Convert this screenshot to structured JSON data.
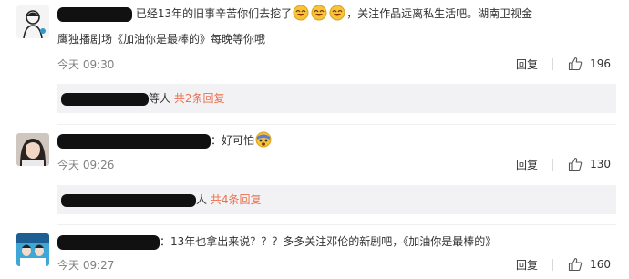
{
  "comments": [
    {
      "text_line1": "已经13年的旧事辛苦你们去挖了",
      "text_line1_after": "，关注作品远离私生活吧。湖南卫视金",
      "text_line2": "鹰独播剧场《加油你是最棒的》每晚等你哦",
      "time": "今天 09:30",
      "reply_label": "回复",
      "likes": "196",
      "thread": {
        "suffix": "等人",
        "more": "共2条回复"
      }
    },
    {
      "text": "：好可怕",
      "time": "今天 09:26",
      "reply_label": "回复",
      "likes": "130",
      "thread": {
        "suffix": "人",
        "more": "共4条回复"
      }
    },
    {
      "text": "：13年也拿出来说？？？多多关注邓伦的新剧吧，《加油你是最棒的》",
      "time": "今天 09:27",
      "reply_label": "回复",
      "likes": "160"
    }
  ],
  "icons": {
    "like": "thumbs-up-icon",
    "emoji_laugh": "grin-emoji-icon",
    "emoji_scared": "scared-emoji-icon"
  },
  "colors": {
    "link": "#eb7350",
    "meta": "#808080",
    "thread_bg": "#f2f2f5"
  }
}
